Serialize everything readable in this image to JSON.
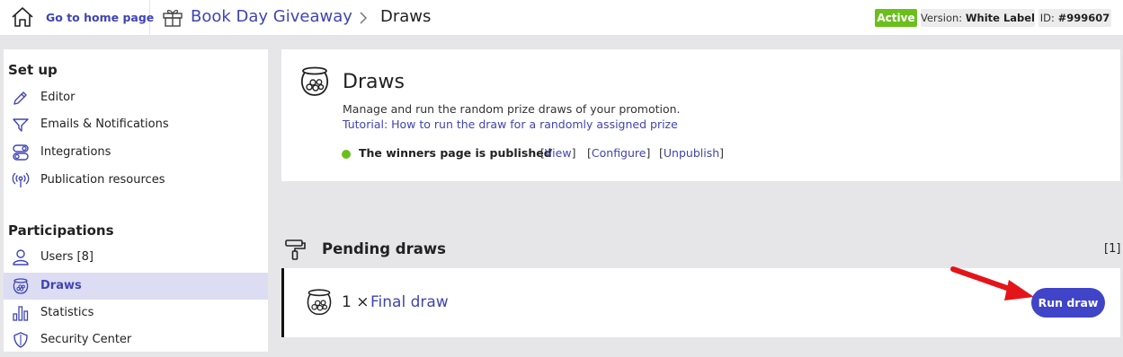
{
  "header": {
    "home_link": "Go to home page",
    "promotion_title": "Book Day Giveaway",
    "current_page": "Draws",
    "status_badge": "Active",
    "version_label": "Version:",
    "version_value": "White Label",
    "id_label": "ID:",
    "id_value": "#999607"
  },
  "sidebar": {
    "setup_heading": "Set up",
    "setup_items": [
      {
        "label": "Editor",
        "icon": "pencil-icon"
      },
      {
        "label": "Emails & Notifications",
        "icon": "send-icon"
      },
      {
        "label": "Integrations",
        "icon": "toggles-icon"
      },
      {
        "label": "Publication resources",
        "icon": "broadcast-icon"
      }
    ],
    "participations_heading": "Participations",
    "participation_items": [
      {
        "label": "Users [8]",
        "icon": "user-icon"
      },
      {
        "label": "Draws",
        "icon": "pot-icon",
        "active": true
      },
      {
        "label": "Statistics",
        "icon": "bar-chart-icon"
      },
      {
        "label": "Security Center",
        "icon": "shield-icon"
      }
    ]
  },
  "intro": {
    "title": "Draws",
    "description": "Manage and run the random prize draws of your promotion.",
    "tutorial_link": "Tutorial: How to run the draw for a randomly assigned prize",
    "winners_status": "The winners page is published",
    "actions": [
      {
        "label": "View"
      },
      {
        "label": "Configure"
      },
      {
        "label": "Unpublish"
      }
    ]
  },
  "pending": {
    "title": "Pending draws",
    "count": "[1]",
    "draw_qty": "1 ×",
    "draw_name": "Final draw",
    "run_button": "Run draw"
  },
  "colors": {
    "accent": "#3f44b5",
    "button": "#3f44c9",
    "status_green": "#6bbf1c",
    "annotation_arrow": "#e3151a",
    "active_sidebar_bg": "#dcdcf2"
  }
}
